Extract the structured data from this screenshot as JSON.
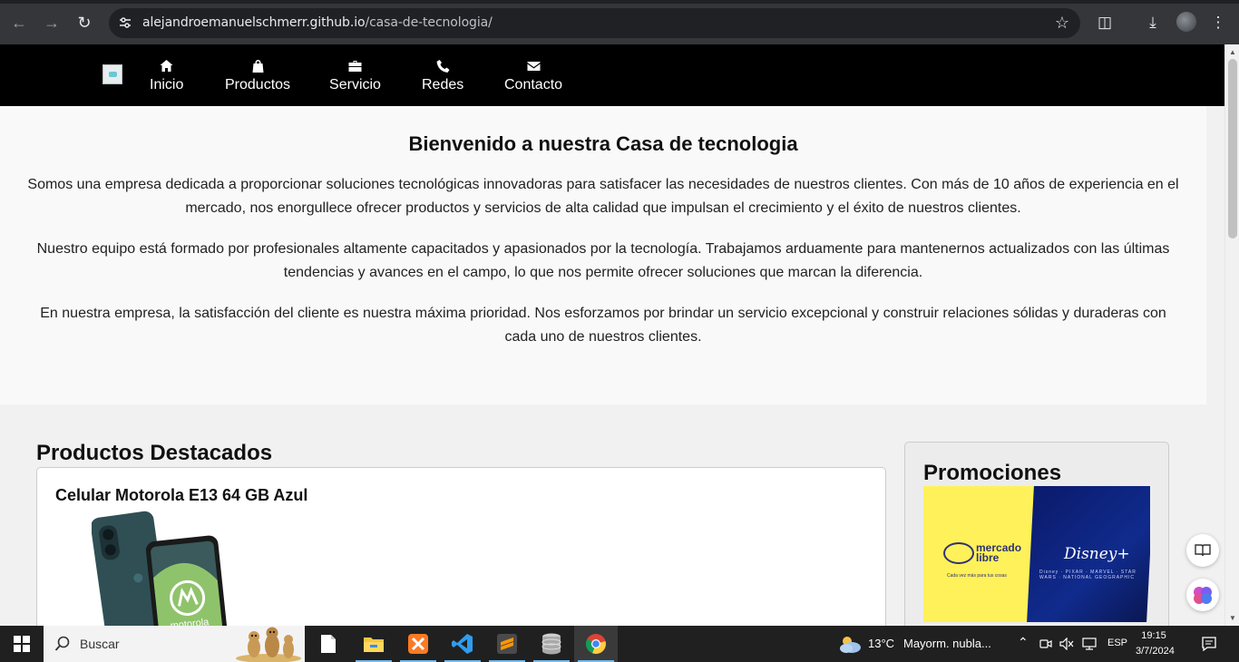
{
  "browser": {
    "url_host": "alejandroemanuelschmerr.github.io",
    "url_path": "/casa-de-tecnologia/"
  },
  "nav": {
    "items": [
      {
        "label": "Inicio",
        "icon": "home-icon"
      },
      {
        "label": "Productos",
        "icon": "shopping-bag-icon"
      },
      {
        "label": "Servicio",
        "icon": "briefcase-icon"
      },
      {
        "label": "Redes",
        "icon": "phone-icon"
      },
      {
        "label": "Contacto",
        "icon": "envelope-icon"
      }
    ]
  },
  "hero": {
    "title": "Bienvenido a nuestra Casa de tecnologia",
    "p1": "Somos una empresa dedicada a proporcionar soluciones tecnológicas innovadoras para satisfacer las necesidades de nuestros clientes. Con más de 10 años de experiencia en el mercado, nos enorgullece ofrecer productos y servicios de alta calidad que impulsan el crecimiento y el éxito de nuestros clientes.",
    "p2": "Nuestro equipo está formado por profesionales altamente capacitados y apasionados por la tecnología. Trabajamos arduamente para mantenernos actualizados con las últimas tendencias y avances en el campo, lo que nos permite ofrecer soluciones que marcan la diferencia.",
    "p3": "En nuestra empresa, la satisfacción del cliente es nuestra máxima prioridad. Nos esforzamos por brindar un servicio excepcional y construir relaciones sólidas y duraderas con cada uno de nuestros clientes."
  },
  "products": {
    "title": "Productos Destacados",
    "items": [
      {
        "name": "Celular Motorola E13 64 GB Azul"
      }
    ]
  },
  "promo": {
    "title": "Promociones",
    "banner": {
      "brand_left_line1": "mercado",
      "brand_left_line2": "libre",
      "brand_left_tagline": "Cada vez más para tus cosas",
      "brand_right": "Disney+",
      "partners": "Disney · PIXAR · MARVEL · STAR WARS · NATIONAL GEOGRAPHIC"
    }
  },
  "taskbar": {
    "search_label": "Buscar",
    "weather_temp": "13°C",
    "weather_desc": "Mayorm. nubla...",
    "language": "ESP",
    "time": "19:15",
    "date": "3/7/2024"
  },
  "colors": {
    "nav_bg": "#000000",
    "hero_bg": "#f9f9f9",
    "page_bg": "#f1f1f1",
    "taskbar_bg": "#202020"
  }
}
